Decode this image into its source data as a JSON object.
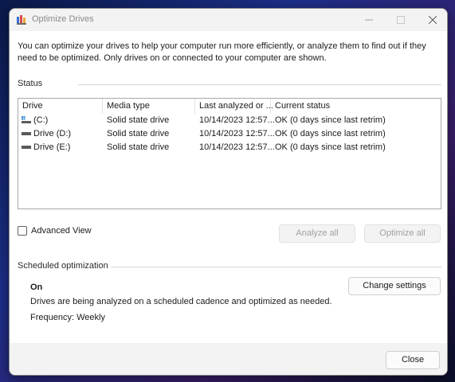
{
  "window": {
    "title": "Optimize Drives",
    "accent": "#0067c0"
  },
  "intro": "You can optimize your drives to help your computer run more efficiently, or analyze them to find out if they need to be optimized. Only drives on or connected to your computer are shown.",
  "status": {
    "label": "Status",
    "columns": [
      "Drive",
      "Media type",
      "Last analyzed or ...",
      "Current status"
    ],
    "rows": [
      {
        "drive": "(C:)",
        "icon": "system-drive-icon",
        "media": "Solid state drive",
        "last": "10/14/2023 12:57...",
        "status": "OK (0 days since last retrim)"
      },
      {
        "drive": "Drive (D:)",
        "icon": "drive-icon",
        "media": "Solid state drive",
        "last": "10/14/2023 12:57...",
        "status": "OK (0 days since last retrim)"
      },
      {
        "drive": "Drive (E:)",
        "icon": "drive-icon",
        "media": "Solid state drive",
        "last": "10/14/2023 12:57...",
        "status": "OK (0 days since last retrim)"
      }
    ]
  },
  "advanced_view": {
    "label": "Advanced View",
    "checked": false
  },
  "buttons": {
    "analyze_all": "Analyze all",
    "optimize_all": "Optimize all",
    "change_settings": "Change settings",
    "close": "Close"
  },
  "scheduled": {
    "label": "Scheduled optimization",
    "state": "On",
    "description": "Drives are being analyzed on a scheduled cadence and optimized as needed.",
    "frequency": "Frequency: Weekly"
  }
}
